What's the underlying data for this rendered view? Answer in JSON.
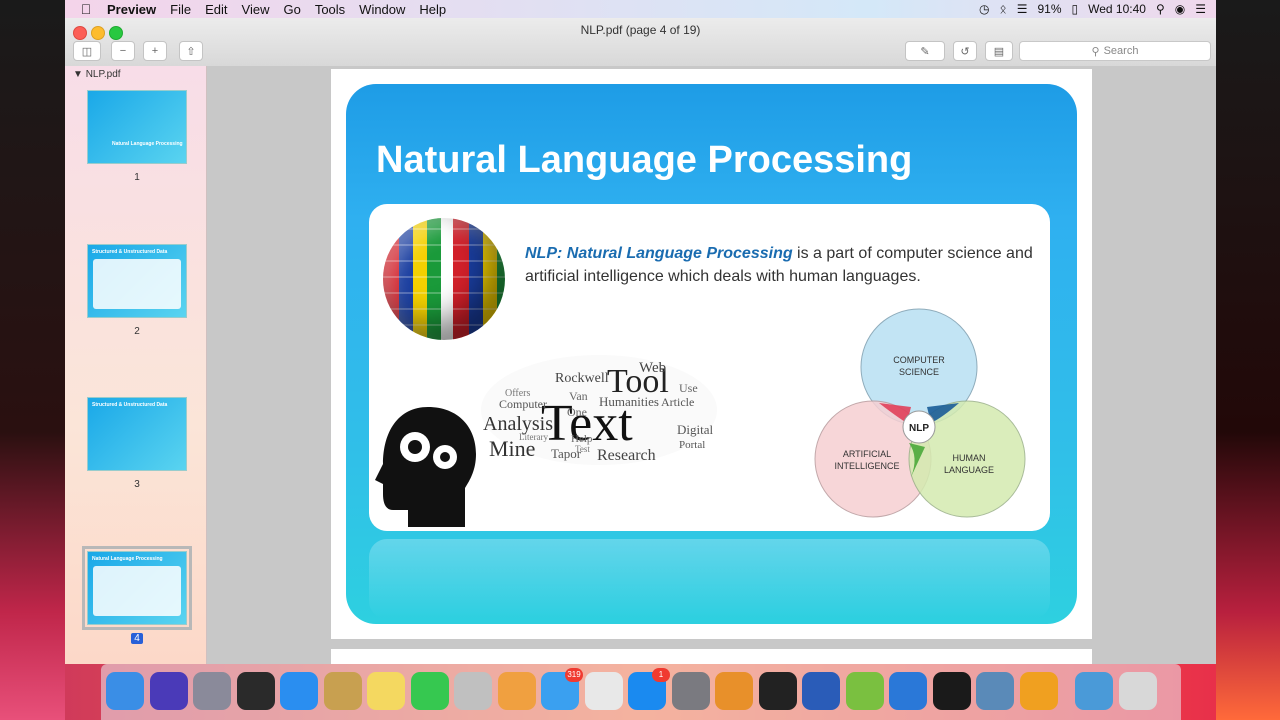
{
  "menubar": {
    "app_name": "Preview",
    "items": [
      "File",
      "Edit",
      "View",
      "Go",
      "Tools",
      "Window",
      "Help"
    ],
    "battery": "91%",
    "clock": "Wed 10:40"
  },
  "window": {
    "title": "NLP.pdf (page 4 of 19)",
    "search_placeholder": "Search"
  },
  "sidebar": {
    "file_name": "NLP.pdf",
    "pages": [
      {
        "number": "1",
        "thumb_title": "Natural Language Processing"
      },
      {
        "number": "2",
        "thumb_title": "Structured & Unstructured Data"
      },
      {
        "number": "3",
        "thumb_title": "Structured & Unstructured Data"
      },
      {
        "number": "4",
        "thumb_title": "Natural Language Processing"
      }
    ],
    "selected_page": "4"
  },
  "slide": {
    "title": "Natural Language Processing",
    "definition_term": "NLP: Natural Language Processing",
    "definition_rest": " is a part of computer science and artificial intelligence which deals with human languages.",
    "venn": {
      "top": [
        "COMPUTER",
        "SCIENCE"
      ],
      "left": [
        "ARTIFICIAL",
        "INTELLIGENCE"
      ],
      "right": [
        "HUMAN",
        "LANGUAGE"
      ],
      "center": "NLP"
    },
    "wordcloud": [
      "Text",
      "Tool",
      "Analysis",
      "Mine",
      "Research",
      "Web",
      "Rockwell",
      "Computer",
      "Humanities",
      "Article",
      "Digital",
      "Portal",
      "Tapor",
      "Help",
      "One",
      "Van",
      "Use",
      "Test",
      "Literary",
      "Offers"
    ]
  },
  "dock": {
    "icons": [
      "finder-icon",
      "siri-icon",
      "launchpad-icon",
      "activity-monitor-icon",
      "safari-icon",
      "preview-icon",
      "notes-icon",
      "facetime-icon",
      "photo-booth-icon",
      "photos-icon",
      "messages-icon",
      "chrome-icon",
      "app-store-icon",
      "system-preferences-icon",
      "sublime-text-icon",
      "terminal-icon",
      "word-icon",
      "android-studio-icon",
      "xcode-icon",
      "pycharm-icon",
      "image-capture-icon",
      "flower-app-icon",
      "downloads-folder-icon",
      "trash-icon"
    ],
    "messages_badge": "319",
    "app_store_badge": "1"
  }
}
